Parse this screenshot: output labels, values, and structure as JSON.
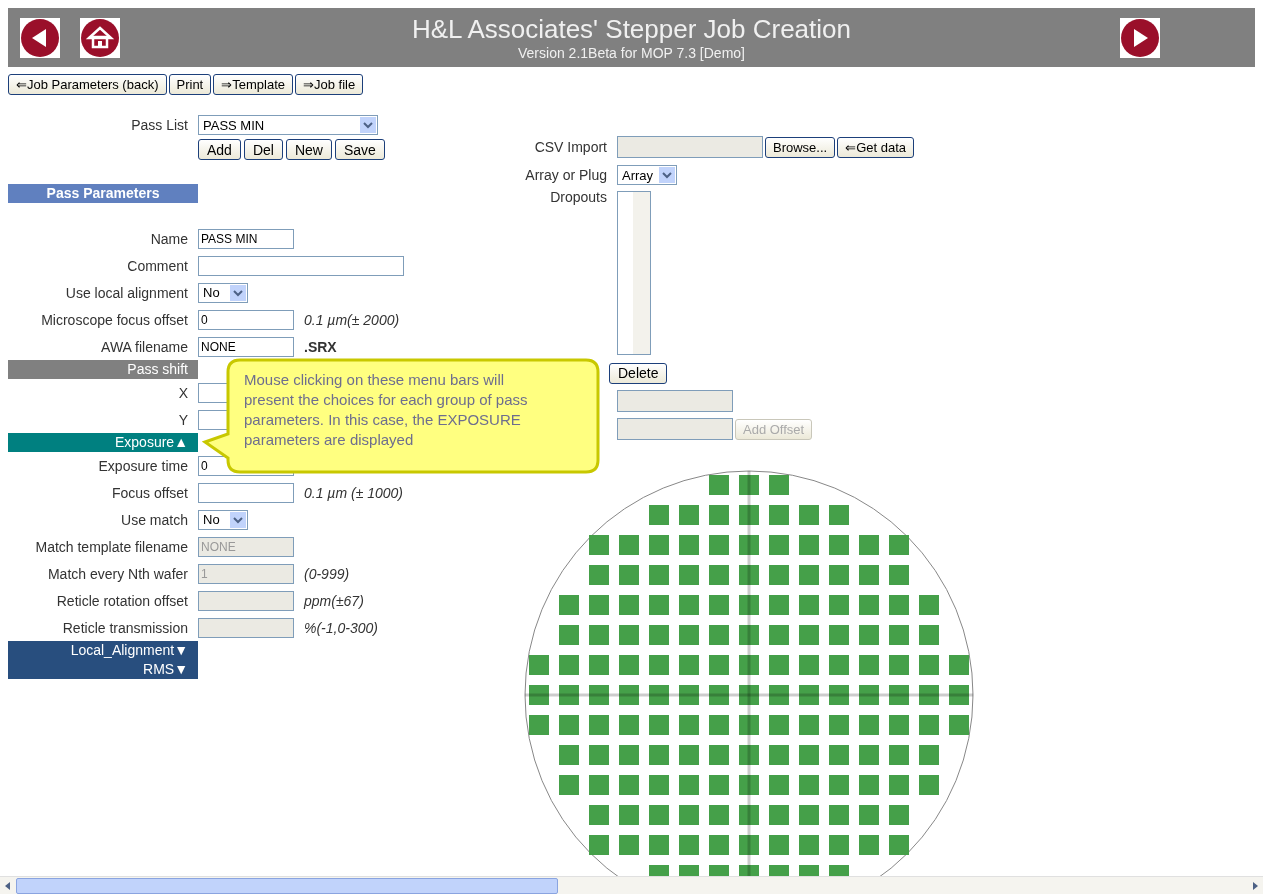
{
  "header": {
    "title": "H&L Associates' Stepper Job Creation",
    "subtitle": "Version 2.1Beta for MOP 7.3   [Demo]"
  },
  "toolbar": [
    {
      "label": "⇐Job Parameters (back)"
    },
    {
      "label": "Print"
    },
    {
      "label": "⇒Template"
    },
    {
      "label": "⇒Job file"
    }
  ],
  "pass_list": {
    "label": "Pass List",
    "value": "PASS MIN",
    "buttons": [
      {
        "label": "Add"
      },
      {
        "label": "Del"
      },
      {
        "label": "New"
      },
      {
        "label": "Save"
      }
    ]
  },
  "parameters": [
    {
      "kind": "heading",
      "label": "Pass Parameters",
      "color": "#6080bf"
    },
    {
      "kind": "input",
      "label": "Name",
      "value": "PASS MIN",
      "disabled": false
    },
    {
      "kind": "long-input",
      "label": "Comment",
      "disabled": false
    },
    {
      "kind": "select",
      "label": "Use local alignment",
      "value": "No"
    },
    {
      "kind": "input",
      "label": "Microscope focus offset",
      "value": "0",
      "hint": "0.1 µm(± 2000)",
      "disabled": false
    },
    {
      "kind": "input",
      "label": "AWA filename",
      "value": "NONE",
      "suffix": ".SRX",
      "disabled": false
    },
    {
      "kind": "bar",
      "label": "Pass shift",
      "color": "#808080"
    },
    {
      "kind": "short-input",
      "label": "X",
      "disabled": false
    },
    {
      "kind": "short-input",
      "label": "Y",
      "disabled": false
    },
    {
      "kind": "bar",
      "label": "Exposure",
      "arrow": "▲",
      "color": "#008080"
    },
    {
      "kind": "input",
      "label": "Exposure time",
      "value": "0",
      "disabled": false
    },
    {
      "kind": "input",
      "label": "Focus offset",
      "hint": "0.1 µm (± 1000)",
      "disabled": false
    },
    {
      "kind": "select",
      "label": "Use match",
      "value": "No"
    },
    {
      "kind": "input",
      "label": "Match template filename",
      "value": "NONE",
      "disabled": true
    },
    {
      "kind": "input",
      "label": "Match every Nth wafer",
      "value": "1",
      "hint": "(0-999)",
      "disabled": true
    },
    {
      "kind": "input",
      "label": "Reticle rotation offset",
      "hint": "ppm(±67)",
      "disabled": true
    },
    {
      "kind": "input",
      "label": "Reticle transmission",
      "hint": "%(-1,0-300)",
      "disabled": true
    },
    {
      "kind": "bar",
      "label": "Local_Alignment",
      "arrow": "▼",
      "color": "#284e7e"
    },
    {
      "kind": "bar",
      "label": "RMS",
      "arrow": "▼",
      "color": "#284e7e"
    }
  ],
  "import": {
    "csv_label": "CSV Import",
    "buttons": [
      {
        "label": "Browse..."
      },
      {
        "label": "⇐Get data"
      }
    ],
    "array_label": "Array or Plug",
    "array_value": "Array",
    "dropouts_label": "Dropouts",
    "delete_button": "Delete",
    "add_offset_button": "Add Offset"
  },
  "callout": {
    "text": "Mouse clicking on these menu bars will present the choices for each group of pass parameters. In this case, the EXPOSURE parameters are displayed"
  }
}
